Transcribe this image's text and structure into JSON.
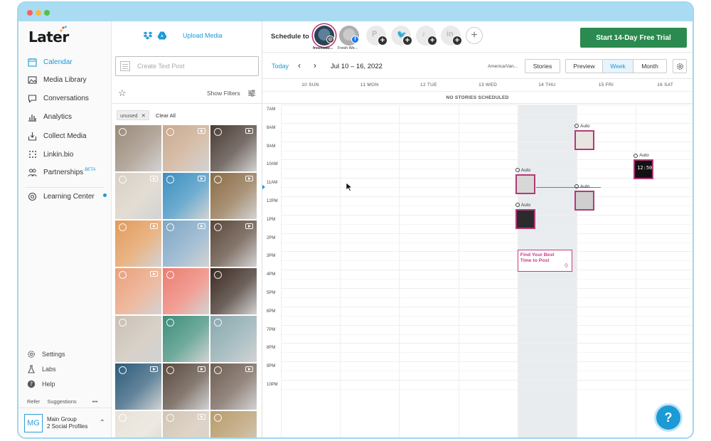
{
  "brand": {
    "logo": "Later"
  },
  "sidebar": {
    "items": [
      {
        "label": "Calendar",
        "icon": "calendar-icon",
        "active": true
      },
      {
        "label": "Media Library",
        "icon": "image-icon"
      },
      {
        "label": "Conversations",
        "icon": "chat-icon"
      },
      {
        "label": "Analytics",
        "icon": "bar-chart-icon"
      },
      {
        "label": "Collect Media",
        "icon": "download-icon"
      },
      {
        "label": "Linkin.bio",
        "icon": "link-grid-icon"
      },
      {
        "label": "Partnerships",
        "icon": "people-icon",
        "badge": "BETA"
      }
    ],
    "learning_center": "Learning Center",
    "bottom": {
      "settings": "Settings",
      "labs": "Labs",
      "help": "Help"
    },
    "refer": "Refer",
    "suggestions": "Suggestions",
    "more": "•••",
    "profile": {
      "initials": "MG",
      "name": "Main Group",
      "subtitle": "2 Social Profiles"
    }
  },
  "media": {
    "upload_label": "Upload Media",
    "text_post_placeholder": "Create Text Post",
    "show_filters": "Show Filters",
    "tag": "unused",
    "clear_all": "Clear All",
    "thumbs": [
      {
        "c": "#9a8a7a",
        "v": false
      },
      {
        "c": "#c9a98e",
        "v": true
      },
      {
        "c": "#4a3c35",
        "v": true
      },
      {
        "c": "#d8d0c4",
        "v": true
      },
      {
        "c": "#3a8fbf",
        "v": true
      },
      {
        "c": "#8a6b45",
        "v": true
      },
      {
        "c": "#e29a5a",
        "v": true
      },
      {
        "c": "#7fa6c4",
        "v": true
      },
      {
        "c": "#5a4638",
        "v": true
      },
      {
        "c": "#e9a07c",
        "v": true
      },
      {
        "c": "#ec7c6f",
        "v": false
      },
      {
        "c": "#3b2a22",
        "v": false
      },
      {
        "c": "#c9c0b4",
        "v": false
      },
      {
        "c": "#3e8d7a",
        "v": false
      },
      {
        "c": "#8aa8ad",
        "v": false
      },
      {
        "c": "#2c5a78",
        "v": true
      },
      {
        "c": "#5a4a3e",
        "v": true
      },
      {
        "c": "#6e5d52",
        "v": true
      },
      {
        "c": "#e7e2d8",
        "v": false
      },
      {
        "c": "#d2c5b4",
        "v": true
      },
      {
        "c": "#b79b6c",
        "v": false
      }
    ]
  },
  "topbar": {
    "schedule_to": "Schedule to",
    "accounts": [
      {
        "label": "freshwav...",
        "type": "instagram",
        "selected": true
      },
      {
        "label": "Fresh We...",
        "type": "facebook",
        "selected": false
      },
      {
        "label": "",
        "type": "pinterest",
        "add": true
      },
      {
        "label": "",
        "type": "twitter",
        "add": true
      },
      {
        "label": "",
        "type": "tiktok",
        "add": true
      },
      {
        "label": "",
        "type": "linkedin",
        "add": true
      }
    ],
    "add_icon": "+",
    "trial_button": "Start 14-Day Free Trial"
  },
  "calendar": {
    "today": "Today",
    "range": "Jul 10 – 16, 2022",
    "timezone": "America/Van...",
    "stories": "Stories",
    "views": [
      "Preview",
      "Week",
      "Month"
    ],
    "selected_view": "Week",
    "days": [
      "10 SUN",
      "11 MON",
      "12 TUE",
      "13 WED",
      "14 THU",
      "15 FRI",
      "16 SAT"
    ],
    "highlight_day": 4,
    "no_stories": "NO STORIES SCHEDULED",
    "hours": [
      "7AM",
      "8AM",
      "9AM",
      "10AM",
      "11AM",
      "12PM",
      "1PM",
      "2PM",
      "3PM",
      "4PM",
      "5PM",
      "6PM",
      "7PM",
      "8PM",
      "9PM",
      "10PM"
    ],
    "posts": [
      {
        "day": 5,
        "hour": 8.0,
        "label": "Auto",
        "color": "#e8e4df"
      },
      {
        "day": 6,
        "hour": 9.6,
        "label": "Auto",
        "color": "#111111",
        "text": "12:50"
      },
      {
        "day": 4,
        "hour": 10.4,
        "label": "Auto",
        "color": "#d7d7d7"
      },
      {
        "day": 5,
        "hour": 11.3,
        "label": "Auto",
        "color": "#cfcfcf"
      },
      {
        "day": 4,
        "hour": 12.3,
        "label": "Auto",
        "color": "#2b2b2b"
      }
    ],
    "best_time": {
      "line1": "Find Your Best",
      "line2": "Time to Post"
    },
    "now_hour": 11.5
  },
  "help_fab": "?"
}
